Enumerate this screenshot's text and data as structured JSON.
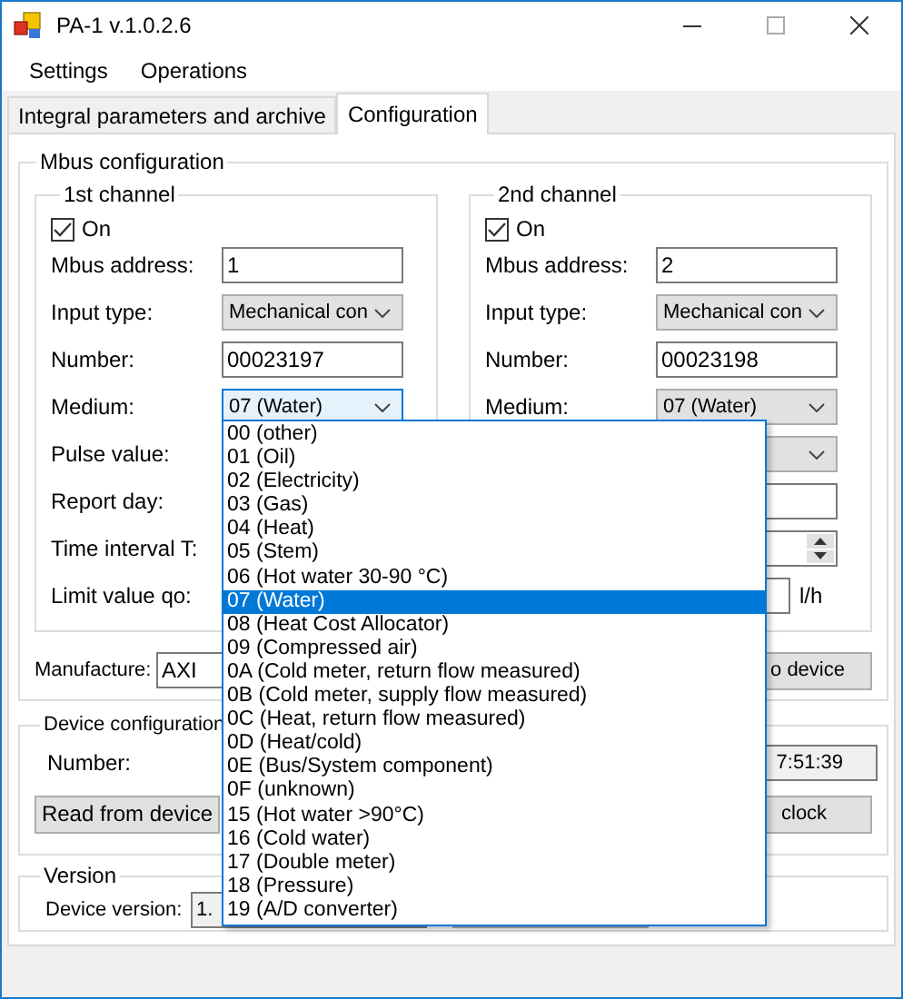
{
  "window": {
    "title": "PA-1 v.1.0.2.6"
  },
  "menu": [
    {
      "label": "Settings"
    },
    {
      "label": "Operations"
    }
  ],
  "tabs": [
    {
      "label": "Integral parameters and archive",
      "selected": false
    },
    {
      "label": "Configuration",
      "selected": true
    }
  ],
  "mbus_configuration": {
    "title": "Mbus configuration",
    "channels": [
      {
        "title": "1st channel",
        "on_label": "On",
        "on": true,
        "rows": [
          {
            "label": "Mbus address:",
            "kind": "text",
            "value": "1"
          },
          {
            "label": "Input type:",
            "kind": "combo",
            "value": "Mechanical con"
          },
          {
            "label": "Number:",
            "kind": "text",
            "value": "00023197"
          },
          {
            "label": "Medium:",
            "kind": "combo",
            "value": "07 (Water)",
            "expanded": true
          },
          {
            "label": "Pulse value:"
          },
          {
            "label": "Report day:"
          },
          {
            "label": "Time interval T:"
          },
          {
            "label": "Limit value qo:"
          }
        ]
      },
      {
        "title": "2nd channel",
        "on_label": "On",
        "on": true,
        "rows": [
          {
            "label": "Mbus address:",
            "kind": "text",
            "value": "2"
          },
          {
            "label": "Input type:",
            "kind": "combo",
            "value": "Mechanical con"
          },
          {
            "label": "Number:",
            "kind": "text",
            "value": "00023198"
          },
          {
            "label": "Medium:",
            "kind": "combo",
            "value": "07 (Water)",
            "expanded": false
          },
          {
            "kind": "combo"
          },
          {
            "kind": "text"
          },
          {
            "kind": "spin"
          },
          {
            "kind": "text",
            "unit": "l/h"
          }
        ]
      }
    ],
    "manufacture": {
      "label": "Manufacture:",
      "value": "AXI"
    },
    "write_button": "o device"
  },
  "medium_options": [
    {
      "label": "00 (other)",
      "selected": false
    },
    {
      "label": "01 (Oil)",
      "selected": false
    },
    {
      "label": "02 (Electricity)",
      "selected": false
    },
    {
      "label": "03 (Gas)",
      "selected": false
    },
    {
      "label": "04 (Heat)",
      "selected": false
    },
    {
      "label": "05 (Stem)",
      "selected": false
    },
    {
      "label": "06 (Hot water 30-90 °C)",
      "selected": false
    },
    {
      "label": "07 (Water)",
      "selected": true
    },
    {
      "label": "08 (Heat Cost Allocator)",
      "selected": false
    },
    {
      "label": "09 (Compressed air)",
      "selected": false
    },
    {
      "label": "0A (Cold meter, return flow measured)",
      "selected": false
    },
    {
      "label": "0B (Cold meter, supply flow measured)",
      "selected": false
    },
    {
      "label": "0C (Heat, return flow measured)",
      "selected": false
    },
    {
      "label": "0D (Heat/cold)",
      "selected": false
    },
    {
      "label": "0E (Bus/System component)",
      "selected": false
    },
    {
      "label": "0F (unknown)",
      "selected": false
    },
    {
      "label": "15 (Hot water >90°C)",
      "selected": false
    },
    {
      "label": "16 (Cold water)",
      "selected": false
    },
    {
      "label": "17 (Double meter)",
      "selected": false
    },
    {
      "label": "18 (Pressure)",
      "selected": false
    },
    {
      "label": "19 (A/D converter)",
      "selected": false
    }
  ],
  "device_configuration": {
    "title": "Device configuration",
    "number_label": "Number:",
    "clock_value": "7:51:39",
    "read_button": "Read from device",
    "clock_button": "clock"
  },
  "version": {
    "title": "Version",
    "device_version_label": "Device version:",
    "device_version_value": "1."
  }
}
